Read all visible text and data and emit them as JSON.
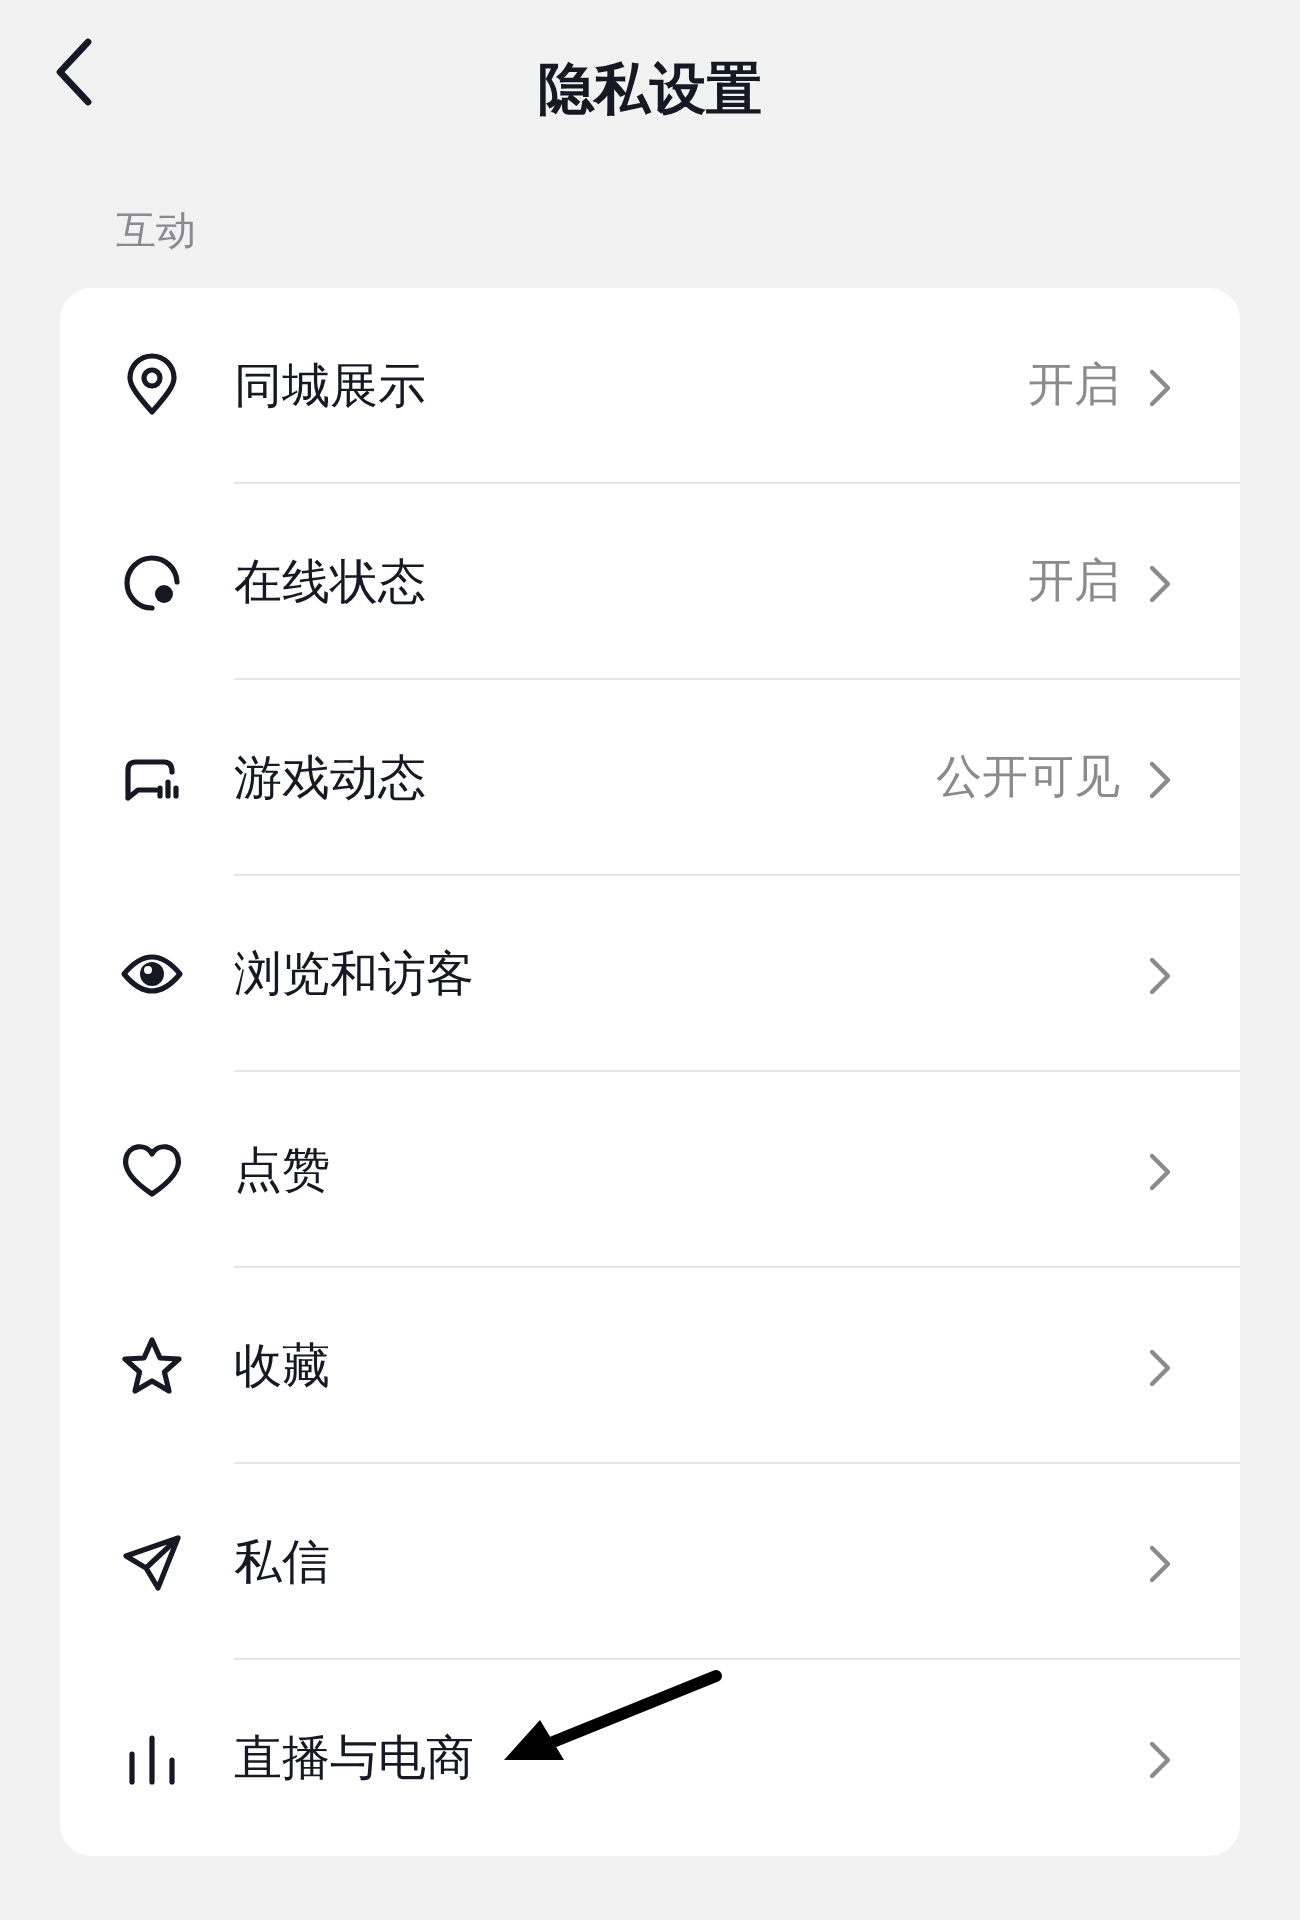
{
  "header": {
    "title": "隐私设置"
  },
  "section": {
    "label": "互动"
  },
  "items": [
    {
      "kind": "location",
      "label": "同城展示",
      "value": "开启"
    },
    {
      "kind": "online",
      "label": "在线状态",
      "value": "开启"
    },
    {
      "kind": "game",
      "label": "游戏动态",
      "value": "公开可见"
    },
    {
      "kind": "eye",
      "label": "浏览和访客"
    },
    {
      "kind": "heart",
      "label": "点赞"
    },
    {
      "kind": "star",
      "label": "收藏"
    },
    {
      "kind": "send",
      "label": "私信"
    },
    {
      "kind": "bars",
      "label": "直播与电商"
    }
  ],
  "pointer_arrow": true
}
